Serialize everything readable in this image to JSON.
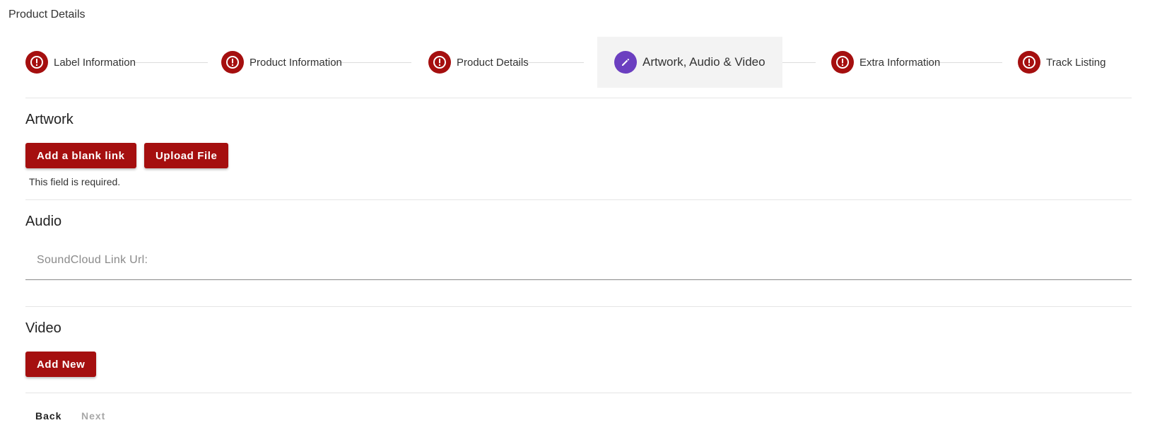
{
  "page_title": "Product Details",
  "stepper": {
    "steps": [
      {
        "label": "Label Information",
        "status": "error",
        "icon": "error-icon"
      },
      {
        "label": "Product Information",
        "status": "error",
        "icon": "error-icon"
      },
      {
        "label": "Product Details",
        "status": "error",
        "icon": "error-icon"
      },
      {
        "label": "Artwork, Audio & Video",
        "status": "editing",
        "icon": "pencil-icon"
      },
      {
        "label": "Extra Information",
        "status": "error",
        "icon": "error-icon"
      },
      {
        "label": "Track Listing",
        "status": "error",
        "icon": "error-icon"
      }
    ]
  },
  "artwork": {
    "title": "Artwork",
    "add_blank_link_label": "Add a blank link",
    "upload_file_label": "Upload File",
    "error_text": "This field is required."
  },
  "audio": {
    "title": "Audio",
    "soundcloud_placeholder": "SoundCloud Link Url:",
    "soundcloud_value": ""
  },
  "video": {
    "title": "Video",
    "add_new_label": "Add New"
  },
  "navigation": {
    "back_label": "Back",
    "next_label": "Next"
  },
  "colors": {
    "primary_red": "#a50f0f",
    "edit_purple": "#6b3fc0",
    "active_step_bg": "#f3f3f3",
    "disabled_text": "#a8a8a8"
  }
}
